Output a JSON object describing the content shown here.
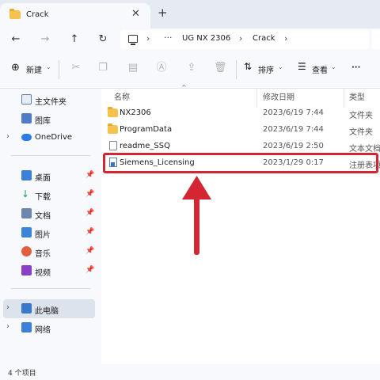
{
  "tab": {
    "title": "Crack",
    "close": "✕",
    "new": "+"
  },
  "nav": {
    "back": "←",
    "forward": "→",
    "up": "↑",
    "refresh": "↻",
    "dots": "···",
    "breadcrumb": [
      "UG NX 2306",
      "Crack"
    ]
  },
  "toolbar": {
    "new_label": "新建",
    "sort_label": "排序",
    "view_label": "查看",
    "more": "···"
  },
  "sidebar": {
    "items": [
      {
        "label": "主文件夹",
        "icon": "home-icon"
      },
      {
        "label": "图库",
        "icon": "gallery-icon"
      },
      {
        "label": "OneDrive",
        "icon": "onedrive-icon"
      },
      {
        "label": "桌面",
        "icon": "desktop-icon"
      },
      {
        "label": "下载",
        "icon": "download-icon"
      },
      {
        "label": "文档",
        "icon": "documents-icon"
      },
      {
        "label": "图片",
        "icon": "pictures-icon"
      },
      {
        "label": "音乐",
        "icon": "music-icon"
      },
      {
        "label": "视频",
        "icon": "videos-icon"
      },
      {
        "label": "此电脑",
        "icon": "pc-icon"
      },
      {
        "label": "网络",
        "icon": "network-icon"
      }
    ]
  },
  "columns": {
    "name": "名称",
    "date": "修改日期",
    "type": "类型"
  },
  "files": [
    {
      "name": "NX2306",
      "date": "2023/6/19 7:44",
      "type": "文件夹",
      "kind": "folder"
    },
    {
      "name": "ProgramData",
      "date": "2023/6/19 7:44",
      "type": "文件夹",
      "kind": "folder"
    },
    {
      "name": "readme_SSQ",
      "date": "2023/6/19 2:50",
      "type": "文本文档",
      "kind": "text"
    },
    {
      "name": "Siemens_Licensing",
      "date": "2023/1/29 0:17",
      "type": "注册表项",
      "kind": "registry"
    }
  ],
  "status": {
    "count": "4 个项目"
  },
  "colors": {
    "highlight": "#d32532",
    "folder": "#f4c24d",
    "selected": "#dde3ec"
  }
}
